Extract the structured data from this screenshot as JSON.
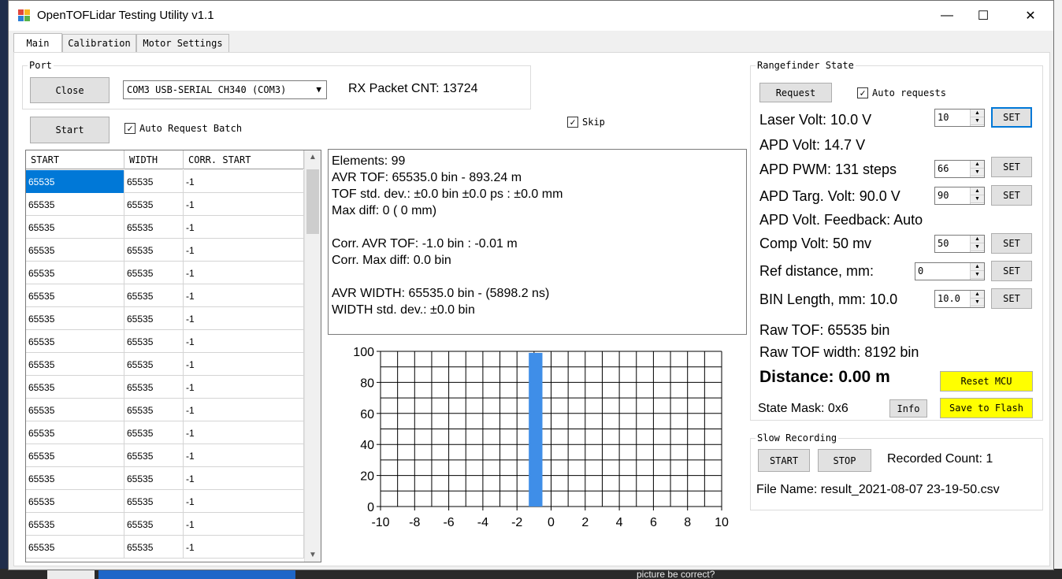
{
  "window": {
    "title": "OpenTOFLidar Testing Utility v1.1",
    "minimize_glyph": "—",
    "maximize_glyph": "☐",
    "close_glyph": "✕"
  },
  "tabs": [
    {
      "label": "Main",
      "active": true
    },
    {
      "label": "Calibration",
      "active": false
    },
    {
      "label": "Motor Settings",
      "active": false
    }
  ],
  "port": {
    "group_label": "Port",
    "close_label": "Close",
    "port_value": "COM3 USB-SERIAL CH340 (COM3)",
    "rx_label": "RX Packet CNT: 13724"
  },
  "controls": {
    "start_label": "Start",
    "auto_batch_label": "Auto Request Batch",
    "auto_batch_checked": true,
    "skip_label": "Skip",
    "skip_checked": true
  },
  "table": {
    "columns": [
      "START",
      "WIDTH",
      "CORR. START"
    ],
    "rows": [
      [
        "65535",
        "65535",
        "-1"
      ],
      [
        "65535",
        "65535",
        "-1"
      ],
      [
        "65535",
        "65535",
        "-1"
      ],
      [
        "65535",
        "65535",
        "-1"
      ],
      [
        "65535",
        "65535",
        "-1"
      ],
      [
        "65535",
        "65535",
        "-1"
      ],
      [
        "65535",
        "65535",
        "-1"
      ],
      [
        "65535",
        "65535",
        "-1"
      ],
      [
        "65535",
        "65535",
        "-1"
      ],
      [
        "65535",
        "65535",
        "-1"
      ],
      [
        "65535",
        "65535",
        "-1"
      ],
      [
        "65535",
        "65535",
        "-1"
      ],
      [
        "65535",
        "65535",
        "-1"
      ],
      [
        "65535",
        "65535",
        "-1"
      ],
      [
        "65535",
        "65535",
        "-1"
      ],
      [
        "65535",
        "65535",
        "-1"
      ],
      [
        "65535",
        "65535",
        "-1"
      ]
    ],
    "selected_row": 0
  },
  "stats": {
    "lines": [
      "Elements: 99",
      "AVR TOF: 65535.0 bin - 893.24  m",
      "TOF std. dev.: ±0.0 bin ±0.0 ps : ±0.0 mm",
      "Max diff: 0 ( 0 mm)",
      "",
      "Corr. AVR TOF: -1.0 bin : -0.01  m",
      "Corr. Max diff: 0.0 bin",
      "",
      "AVR WIDTH: 65535.0 bin - (5898.2 ns)",
      "WIDTH std. dev.: ±0.0 bin"
    ]
  },
  "chart_data": {
    "type": "bar",
    "x": [
      -1
    ],
    "values": [
      99
    ],
    "xlim": [
      -10,
      10
    ],
    "ylim": [
      0,
      100
    ],
    "xticks": [
      -10,
      -8,
      -6,
      -4,
      -2,
      0,
      2,
      4,
      6,
      8,
      10
    ],
    "yticks": [
      0,
      20,
      40,
      60,
      80,
      100
    ],
    "bar_color": "#3f8ee8",
    "grid": true,
    "title": "",
    "xlabel": "",
    "ylabel": ""
  },
  "rangefinder": {
    "group_label": "Rangefinder State",
    "request_label": "Request",
    "auto_requests_label": "Auto requests",
    "auto_requests_checked": true,
    "laser_volt": "Laser Volt: 10.0 V",
    "laser_value": "10",
    "apd_volt": "APD Volt: 14.7 V",
    "apd_pwm": "APD PWM: 131 steps",
    "apd_pwm_value": "66",
    "apd_targ": "APD Targ. Volt: 90.0 V",
    "apd_targ_value": "90",
    "apd_feedback": "APD Volt. Feedback: Auto",
    "comp_volt": "Comp Volt: 50 mv",
    "comp_value": "50",
    "ref_distance": "Ref distance, mm:",
    "ref_value": "0",
    "bin_length": "BIN Length, mm: 10.0",
    "bin_value": "10.0",
    "set_label": "SET",
    "raw_tof": "Raw TOF:  65535 bin",
    "raw_tof_width": "Raw TOF width:  8192 bin",
    "distance": "Distance: 0.00 m",
    "reset_label": "Reset MCU",
    "state_mask": "State Mask: 0x6",
    "info_label": "Info",
    "save_flash_label": "Save to Flash"
  },
  "recording": {
    "group_label": "Slow Recording",
    "start_label": "START",
    "stop_label": "STOP",
    "count_label": "Recorded Count: 1",
    "file_label": "File Name: result_2021-08-07 23-19-50.csv"
  },
  "background": {
    "partial_text": "picture be correct?"
  }
}
